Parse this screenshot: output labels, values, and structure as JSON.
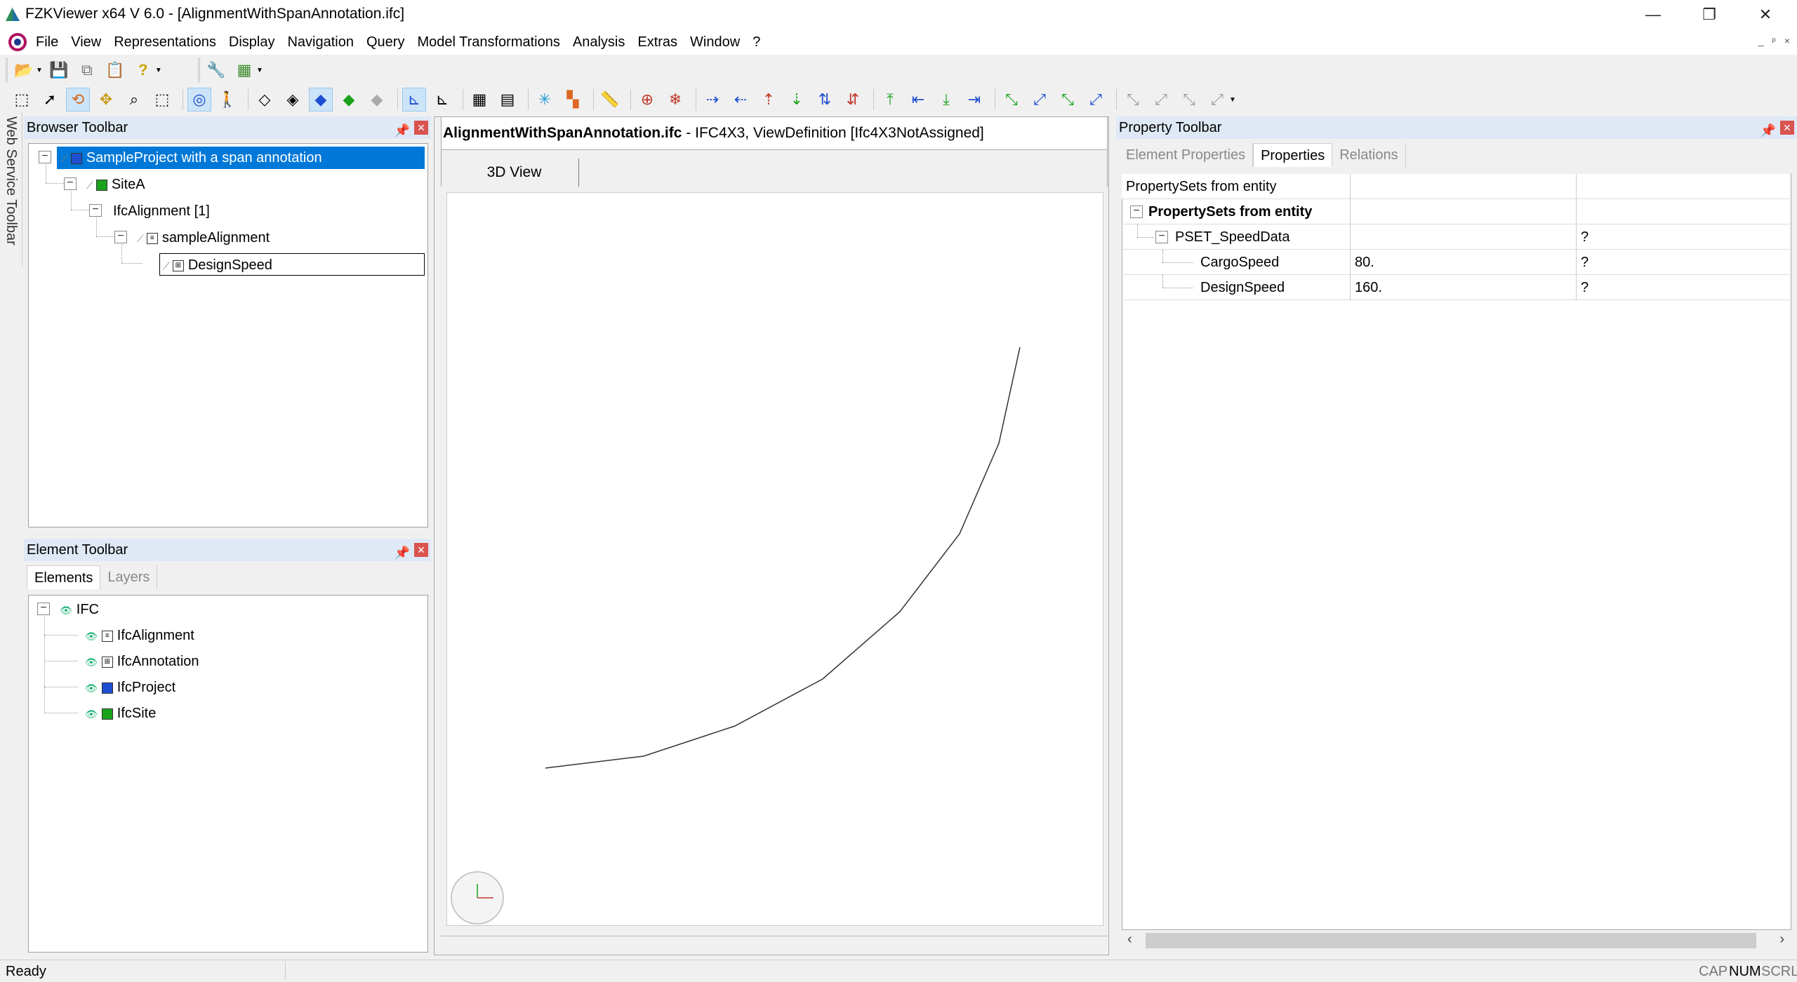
{
  "window": {
    "title": "FZKViewer x64 V 6.0 - [AlignmentWithSpanAnnotation.ifc]",
    "minimize": "—",
    "restore": "❐",
    "close": "✕"
  },
  "menu": {
    "items": [
      "File",
      "View",
      "Representations",
      "Display",
      "Navigation",
      "Query",
      "Model Transformations",
      "Analysis",
      "Extras",
      "Window",
      "?"
    ],
    "mdi_buttons": [
      "_",
      "ᵖ",
      "×"
    ]
  },
  "side_tab": {
    "label": "Web Service Toolbar"
  },
  "browser_toolbar": {
    "title": "Browser Toolbar",
    "tree": [
      {
        "label": "SampleProject with a span annotation"
      },
      {
        "label": "SiteA"
      },
      {
        "label": "IfcAlignment [1]"
      },
      {
        "label": "sampleAlignment"
      },
      {
        "label": "DesignSpeed"
      }
    ]
  },
  "element_toolbar": {
    "title": "Element Toolbar",
    "tabs": [
      "Elements",
      "Layers"
    ],
    "tree": [
      {
        "label": "IFC"
      },
      {
        "label": "IfcAlignment"
      },
      {
        "label": "IfcAnnotation"
      },
      {
        "label": "IfcProject"
      },
      {
        "label": "IfcSite"
      }
    ]
  },
  "document": {
    "filename": "AlignmentWithSpanAnnotation.ifc",
    "details": " - IFC4X3, ViewDefinition [Ifc4X3NotAssigned]",
    "view_tab": "3D View"
  },
  "property_toolbar": {
    "title": "Property Toolbar",
    "tabs": [
      "Element Properties",
      "Properties",
      "Relations"
    ],
    "header": "PropertySets from entity",
    "rows": [
      {
        "name": "PropertySets from entity",
        "value": "",
        "unit": ""
      },
      {
        "name": "PSET_SpeedData",
        "value": "",
        "unit": "?"
      },
      {
        "name": "CargoSpeed",
        "value": "80.",
        "unit": "?"
      },
      {
        "name": "DesignSpeed",
        "value": "160.",
        "unit": "?"
      }
    ]
  },
  "status": {
    "text": "Ready",
    "cap": "CAP",
    "num": "NUM",
    "scrl": "SCRL"
  },
  "colors": {
    "selection": "#0078d7",
    "panel_header": "#dfe9f5",
    "close_button": "#d9534f"
  }
}
